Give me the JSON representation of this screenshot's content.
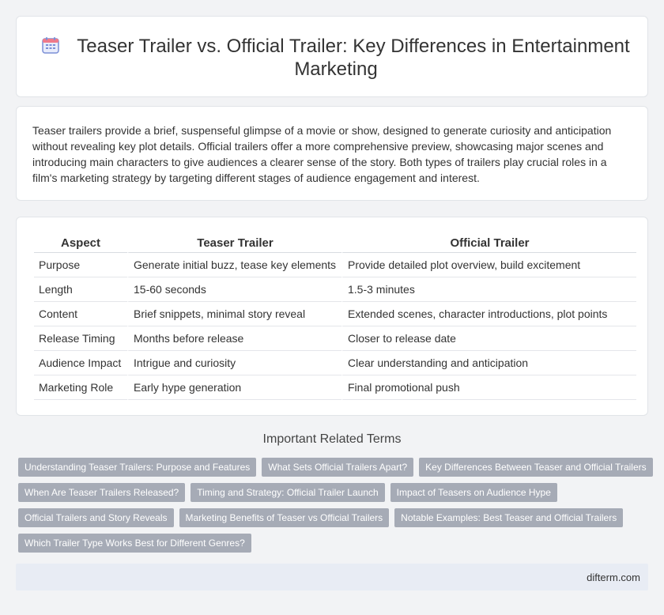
{
  "header": {
    "title": "Teaser Trailer vs. Official Trailer: Key Differences in Entertainment Marketing",
    "icon": "calendar-icon"
  },
  "intro": {
    "text": "Teaser trailers provide a brief, suspenseful glimpse of a movie or show, designed to generate curiosity and anticipation without revealing key plot details. Official trailers offer a more comprehensive preview, showcasing major scenes and introducing main characters to give audiences a clearer sense of the story. Both types of trailers play crucial roles in a film's marketing strategy by targeting different stages of audience engagement and interest."
  },
  "table": {
    "headers": [
      "Aspect",
      "Teaser Trailer",
      "Official Trailer"
    ],
    "rows": [
      [
        "Purpose",
        "Generate initial buzz, tease key elements",
        "Provide detailed plot overview, build excitement"
      ],
      [
        "Length",
        "15-60 seconds",
        "1.5-3 minutes"
      ],
      [
        "Content",
        "Brief snippets, minimal story reveal",
        "Extended scenes, character introductions, plot points"
      ],
      [
        "Release Timing",
        "Months before release",
        "Closer to release date"
      ],
      [
        "Audience Impact",
        "Intrigue and curiosity",
        "Clear understanding and anticipation"
      ],
      [
        "Marketing Role",
        "Early hype generation",
        "Final promotional push"
      ]
    ]
  },
  "related": {
    "heading": "Important Related Terms",
    "rows": [
      [
        "Understanding Teaser Trailers: Purpose and Features",
        "What Sets Official Trailers Apart?",
        "Key Differences Between Teaser and Official Trailers"
      ],
      [
        "When Are Teaser Trailers Released?",
        "Timing and Strategy: Official Trailer Launch",
        "Impact of Teasers on Audience Hype"
      ],
      [
        "Official Trailers and Story Reveals",
        "Marketing Benefits of Teaser vs Official Trailers",
        "Notable Examples: Best Teaser and Official Trailers"
      ],
      [
        "Which Trailer Type Works Best for Different Genres?"
      ]
    ]
  },
  "footer": {
    "site": "difterm.com"
  },
  "colors": {
    "accent_icon": "#7b8fd6",
    "tag_bg": "#a6abb6",
    "footer_bg": "#e8ecf4"
  }
}
